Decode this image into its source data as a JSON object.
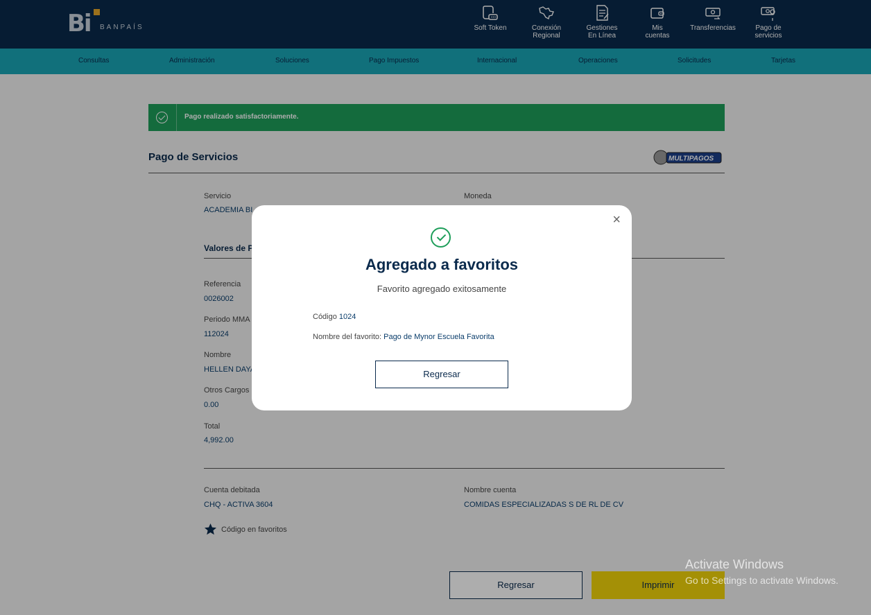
{
  "brand": {
    "logo_text": "Bi",
    "logo_sub": "BANPAÍS"
  },
  "header_links": [
    {
      "line1": "Soft Token",
      "line2": "",
      "icon": "soft-token-icon"
    },
    {
      "line1": "Conexión",
      "line2": "Regional",
      "icon": "conexion-regional-icon"
    },
    {
      "line1": "Gestiones",
      "line2": "En Línea",
      "icon": "gestiones-icon"
    },
    {
      "line1": "Mis",
      "line2": "cuentas",
      "icon": "wallet-icon"
    },
    {
      "line1": "Transferencias",
      "line2": "",
      "icon": "transfer-icon"
    },
    {
      "line1": "Pago de",
      "line2": "servicios",
      "icon": "payment-icon"
    }
  ],
  "nav": [
    "Consultas",
    "Administración",
    "Soluciones",
    "Pago Impuestos",
    "Internacional",
    "Operaciones",
    "Solicitudes",
    "Tarjetas"
  ],
  "alert": {
    "text": "Pago realizado satisfactoriamente."
  },
  "page": {
    "title": "Pago de Servicios",
    "multipagos_label": "MULTIPAGOS",
    "servicio_label": "Servicio",
    "servicio_value": "ACADEMIA BI",
    "moneda_label": "Moneda",
    "valores_title": "Valores de P",
    "fields": [
      {
        "label": "Referencia",
        "value": "0026002"
      },
      {
        "label": "Periodo MMA",
        "value": "112024"
      },
      {
        "label": "Nombre",
        "value": "HELLEN DAYA"
      },
      {
        "label": "Otros Cargos",
        "value": "0.00"
      },
      {
        "label": "Total",
        "value": "4,992.00"
      }
    ],
    "cuenta_label": "Cuenta debitada",
    "cuenta_value": "CHQ - ACTIVA 3604",
    "nombre_cuenta_label": "Nombre cuenta",
    "nombre_cuenta_value": "COMIDAS ESPECIALIZADAS S DE RL DE CV",
    "favorito_text": "Código en favoritos",
    "regresar_label": "Regresar",
    "imprimir_label": "Imprimir"
  },
  "modal": {
    "close": "×",
    "title": "Agregado a favoritos",
    "subtitle": "Favorito agregado exitosamente",
    "codigo_label": "Código",
    "codigo_value": "1024",
    "nombre_label": "Nombre del favorito:",
    "nombre_value": "Pago de Mynor Escuela Favorita",
    "button": "Regresar"
  },
  "watermark": {
    "line1": "Activate Windows",
    "line2": "Go to Settings to activate Windows."
  },
  "colors": {
    "navy": "#0a2a4c",
    "teal": "#1aa6b6",
    "success": "#1e9e5a",
    "yellow": "#f2d40a"
  }
}
